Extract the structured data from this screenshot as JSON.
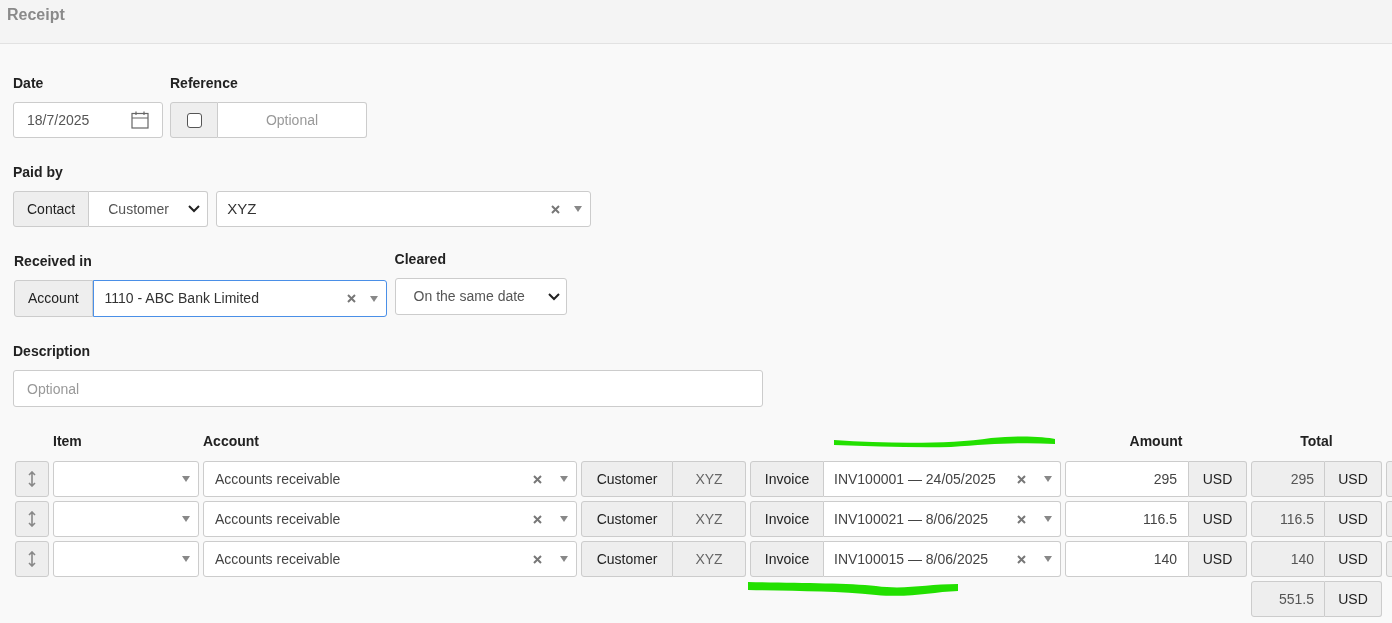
{
  "window": {
    "title": "Receipt"
  },
  "date": {
    "label": "Date",
    "value": "18/7/2025"
  },
  "reference": {
    "label": "Reference",
    "checked": false,
    "placeholder": "Optional"
  },
  "paid_by": {
    "label": "Paid by",
    "addon": "Contact",
    "type": "Customer",
    "contact": "XYZ"
  },
  "received_in": {
    "label": "Received in",
    "addon": "Account",
    "account": "1110 - ABC Bank Limited",
    "focused": true
  },
  "cleared": {
    "label": "Cleared",
    "value": "On the same date"
  },
  "description": {
    "label": "Description",
    "placeholder": "Optional"
  },
  "lines": {
    "columns": [
      "Item",
      "Account",
      "Amount",
      "Total"
    ],
    "rows": [
      {
        "account": "Accounts receivable",
        "contact_type": "Customer",
        "contact": "XYZ",
        "document_type": "Invoice",
        "invoice": "INV100001 — 24/05/2025",
        "amount": "295",
        "currency": "USD",
        "total": "295",
        "total_currency": "USD"
      },
      {
        "account": "Accounts receivable",
        "contact_type": "Customer",
        "contact": "XYZ",
        "document_type": "Invoice",
        "invoice": "INV100021 — 8/06/2025",
        "amount": "116.5",
        "currency": "USD",
        "total": "116.5",
        "total_currency": "USD"
      },
      {
        "account": "Accounts receivable",
        "contact_type": "Customer",
        "contact": "XYZ",
        "document_type": "Invoice",
        "invoice": "INV100015 — 8/06/2025",
        "amount": "140",
        "currency": "USD",
        "total": "140",
        "total_currency": "USD"
      }
    ],
    "grand_total": {
      "value": "551.5",
      "currency": "USD"
    }
  }
}
